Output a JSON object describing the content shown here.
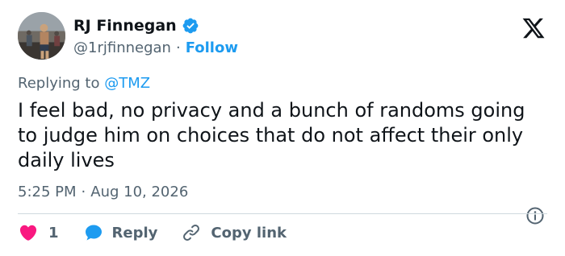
{
  "author": {
    "name": "RJ Finnegan",
    "handle": "@1rjfinnegan",
    "separator": "·",
    "follow_label": "Follow"
  },
  "reply_context": {
    "prefix": "Replying to",
    "mention": "@TMZ"
  },
  "tweet": {
    "text": "I feel bad, no privacy and a bunch of randoms going to judge him on choices that do not affect their only daily lives",
    "time": "5:25 PM",
    "separator": "·",
    "date": "Aug 10, 2026"
  },
  "actions": {
    "like_count": "1",
    "reply_label": "Reply",
    "copy_label": "Copy link"
  },
  "icons": {
    "verified": "verified-badge-icon",
    "logo": "x-logo-icon",
    "info": "info-icon",
    "like": "heart-icon",
    "reply": "reply-bubble-icon",
    "copy": "link-icon"
  },
  "colors": {
    "accent": "#1d9bf0",
    "like": "#f91880",
    "text": "#0f1419",
    "muted": "#536471",
    "divider": "#cfd9de"
  }
}
